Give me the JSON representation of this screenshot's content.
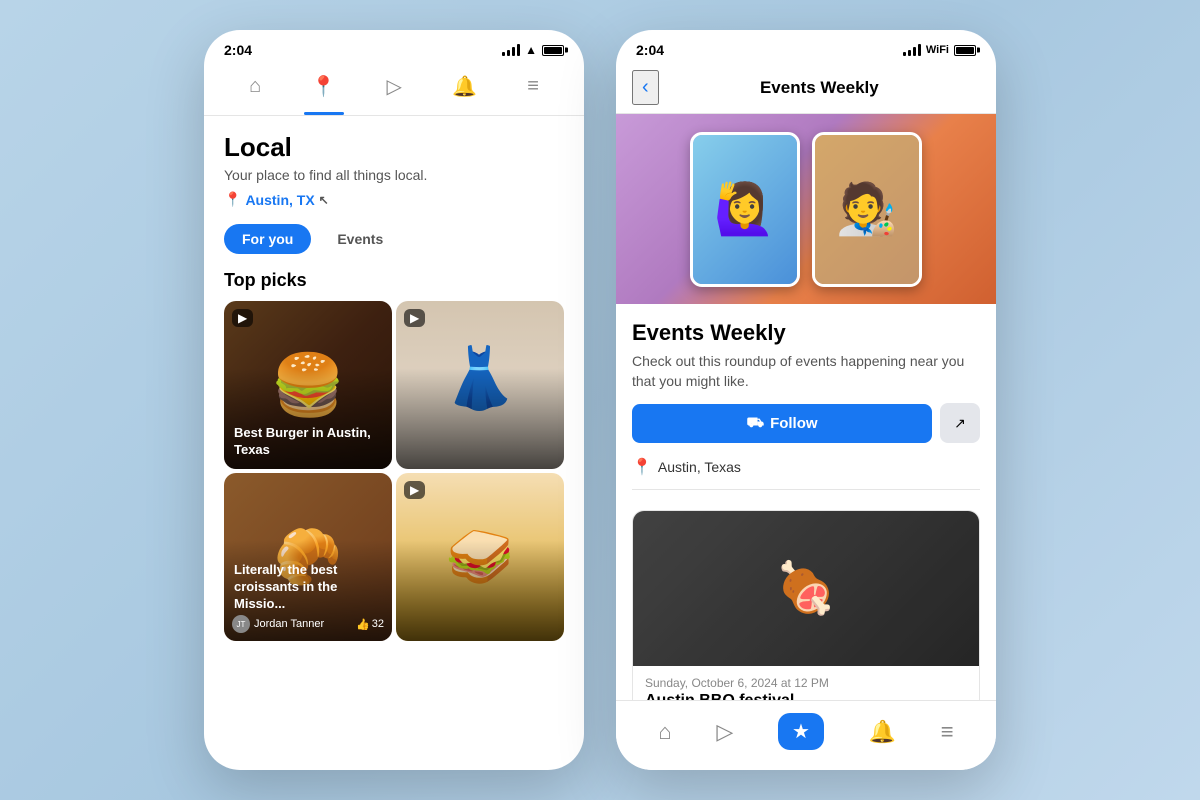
{
  "left_phone": {
    "status": {
      "time": "2:04",
      "signal": 4,
      "wifi": true,
      "battery": 85
    },
    "nav": {
      "items": [
        {
          "label": "Home",
          "icon": "🏠",
          "active": false
        },
        {
          "label": "Local",
          "icon": "📍",
          "active": true
        },
        {
          "label": "Video",
          "icon": "▶",
          "active": false
        },
        {
          "label": "Bell",
          "icon": "🔔",
          "active": false
        },
        {
          "label": "Menu",
          "icon": "≡",
          "active": false
        }
      ]
    },
    "header": {
      "title": "Local",
      "subtitle": "Your place to find all things local.",
      "location": "Austin, TX"
    },
    "tabs": [
      {
        "label": "For you",
        "active": true
      },
      {
        "label": "Events",
        "active": false
      }
    ],
    "section": "Top picks",
    "cards": [
      {
        "id": 1,
        "img_type": "burger",
        "has_video": true,
        "label": "Best Burger in Austin, Texas",
        "author": null,
        "likes": null
      },
      {
        "id": 2,
        "img_type": "fashion",
        "has_video": true,
        "label": null,
        "author": null,
        "likes": null
      },
      {
        "id": 3,
        "img_type": "croissant",
        "has_video": false,
        "label": "Literally the best croissants in the Missio...",
        "author": "Jordan Tanner",
        "likes": "32"
      },
      {
        "id": 4,
        "img_type": "sandwich",
        "has_video": true,
        "label": null,
        "author": null,
        "likes": null
      }
    ]
  },
  "right_phone": {
    "status": {
      "time": "2:04",
      "signal": 4,
      "wifi": true,
      "battery": 85
    },
    "header": {
      "back_label": "‹",
      "title": "Events Weekly"
    },
    "page": {
      "name": "Events Weekly",
      "description": "Check out this roundup of events happening near you that you might like.",
      "follow_label": "Follow",
      "share_icon": "↗",
      "location": "Austin, Texas"
    },
    "event": {
      "date": "Sunday, October 6, 2024 at 12 PM",
      "title": "Austin BBQ festival"
    },
    "bottom_nav": {
      "items": [
        {
          "label": "Home",
          "icon": "🏠",
          "active": false
        },
        {
          "label": "Video",
          "icon": "▶",
          "active": false
        },
        {
          "label": "Local",
          "icon": "⭐",
          "active": true
        },
        {
          "label": "Bell",
          "icon": "🔔",
          "active": false
        },
        {
          "label": "Menu",
          "icon": "≡",
          "active": false
        }
      ]
    }
  }
}
